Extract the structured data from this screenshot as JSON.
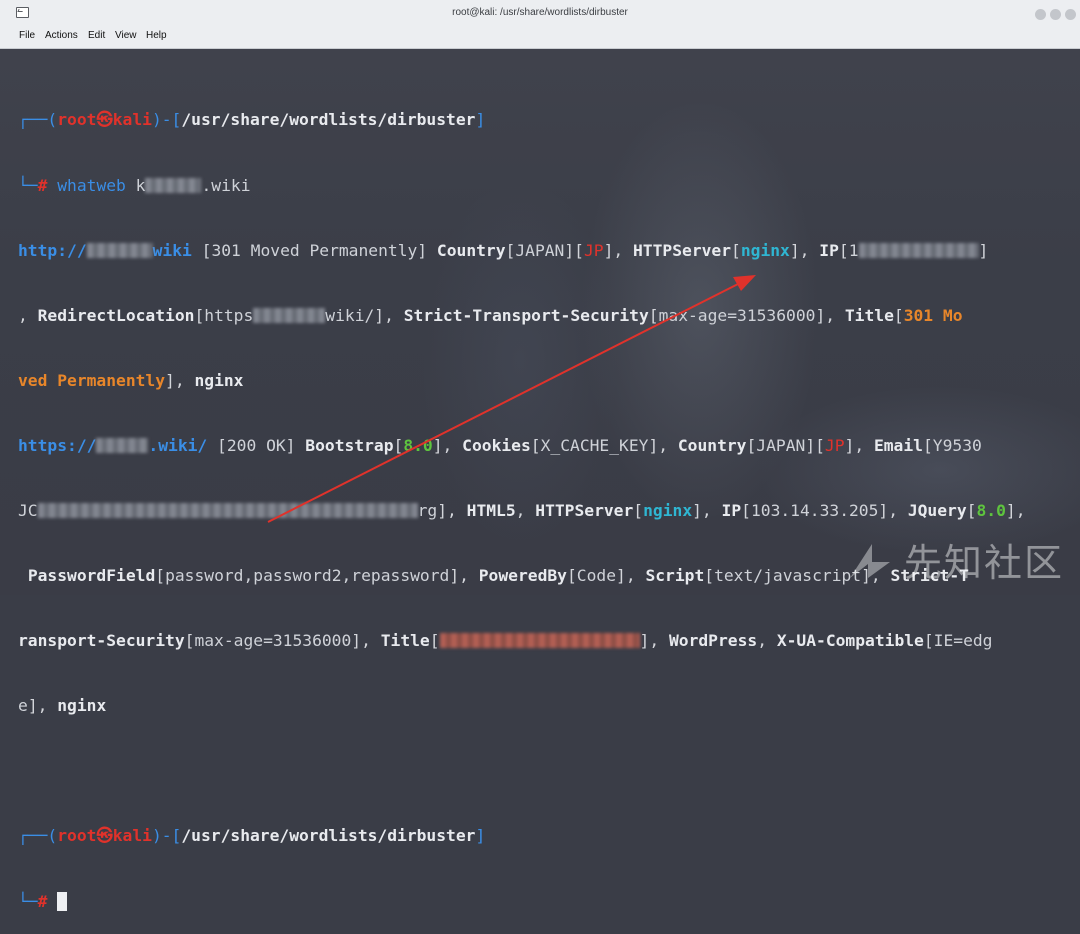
{
  "window": {
    "title": "root@kali: /usr/share/wordlists/dirbuster"
  },
  "menu": [
    "File",
    "Actions",
    "Edit",
    "View",
    "Help"
  ],
  "prompt": {
    "user": "root",
    "at": "㉿",
    "host": "kali",
    "cwd": "/usr/share/wordlists/dirbuster",
    "corner_top": "┌──(",
    "corner_mid": ")-[",
    "corner_end": "]",
    "corner_bottom": "└─",
    "hash": "#"
  },
  "command": {
    "name": "whatweb",
    "arg_prefix": "k",
    "arg_suffix": ".wiki"
  },
  "output": {
    "r1_url_a": "http://",
    "r1_url_b": "wiki",
    "r1_status": " [301 Moved Permanently] ",
    "country_key": "Country",
    "country_val": "JAPAN",
    "country_code": "JP",
    "httpserver_key": "HTTPServer",
    "nginx": "nginx",
    "ip_key": "IP",
    "ip_partial": "1",
    "redirect_key": "RedirectLocation",
    "redirect_a": "https",
    "redirect_b": "wiki/",
    "sts_key": "Strict-Transport-Security",
    "sts_val": "max-age=31536000",
    "title_key": "Title",
    "title_301_a": "301 Mo",
    "title_301_b": "ved Permanently",
    "r2_url_a": "https://",
    "r2_url_b": ".wiki/",
    "r2_status": " [200 OK] ",
    "bootstrap_key": "Bootstrap",
    "bootstrap_val": "8.0",
    "cookies_key": "Cookies",
    "cookies_val": "X_CACHE_KEY",
    "email_key": "Email",
    "email_partial": "Y9530",
    "email_line_a": "JC",
    "email_line_b": "rg",
    "html5": "HTML5",
    "ip_val": "103.14.33.205",
    "jquery_key": "JQuery",
    "jquery_val": "8.0",
    "password_key": "PasswordField",
    "password_val": "password,password2,repassword",
    "powered_key": "PoweredBy",
    "powered_val": "Code",
    "script_key": "Script",
    "script_val": "text/javascript",
    "strict_a": "Strict-T",
    "strict_b": "ransport-Security",
    "wordpress": "WordPress",
    "xua_key": "X-UA-Compatible",
    "xua_val_a": "IE=edg",
    "xua_val_b": "e"
  },
  "watermark": "先知社区",
  "colors": {
    "prompt_blue": "#3a8ee6",
    "root_red": "#e0322b",
    "title_orange": "#e8862a",
    "server_cyan": "#2fb6d2",
    "version_green": "#5ec43e",
    "arrow_red": "#e0322b"
  }
}
